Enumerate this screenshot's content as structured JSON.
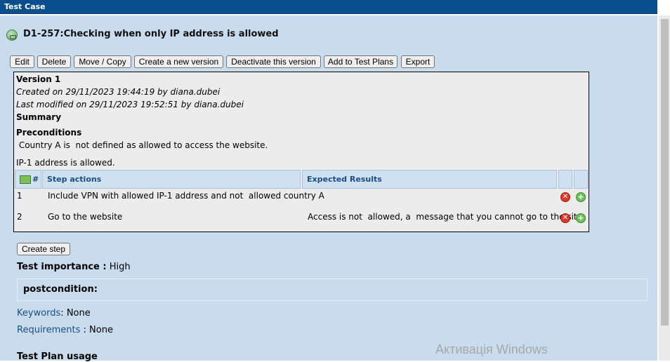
{
  "window": {
    "title": "Test Case"
  },
  "testcase": {
    "title": "D1-257:Checking when only IP address is allowed"
  },
  "toolbar": {
    "edit": "Edit",
    "delete": "Delete",
    "move_copy": "Move / Copy",
    "create_version": "Create a new version",
    "deactivate": "Deactivate this version",
    "add_to_plans": "Add to Test Plans",
    "export": "Export"
  },
  "version": {
    "label": "Version 1",
    "created": "Created on 29/11/2023 19:44:19  by diana.dubei",
    "modified": "Last modified on  29/11/2023 19:52:51  by diana.dubei",
    "summary_label": "Summary",
    "preconditions_label": "Preconditions",
    "precondition_line1": " Country A is  not defined as allowed to access the website.",
    "precondition_line2": "IP-1 address is allowed."
  },
  "steps": {
    "col_number": "#",
    "col_actions": "Step actions",
    "col_expected": "Expected Results",
    "rows": [
      {
        "num": "1",
        "action": "Include VPN with allowed IP-1 address and not  allowed country A",
        "expected": ""
      },
      {
        "num": "2",
        "action": "Go to the website",
        "expected": "Access is not  allowed, a  message that you cannot go to the site"
      }
    ]
  },
  "create_step": "Create step",
  "importance": {
    "label": "Test importance :",
    "value": "High"
  },
  "postcondition": {
    "label": "postcondition:"
  },
  "keywords": {
    "label": "Keywords",
    "value": "None"
  },
  "requirements": {
    "label": "Requirements",
    "value": "None"
  },
  "plan_usage": {
    "label": "Test Plan usage"
  },
  "watermark": "Активація Windows",
  "icons": {
    "testcase": "testcase-icon",
    "reorder": "reorder-steps-icon",
    "delete_step": "delete-step-icon",
    "add_step": "add-step-icon"
  }
}
